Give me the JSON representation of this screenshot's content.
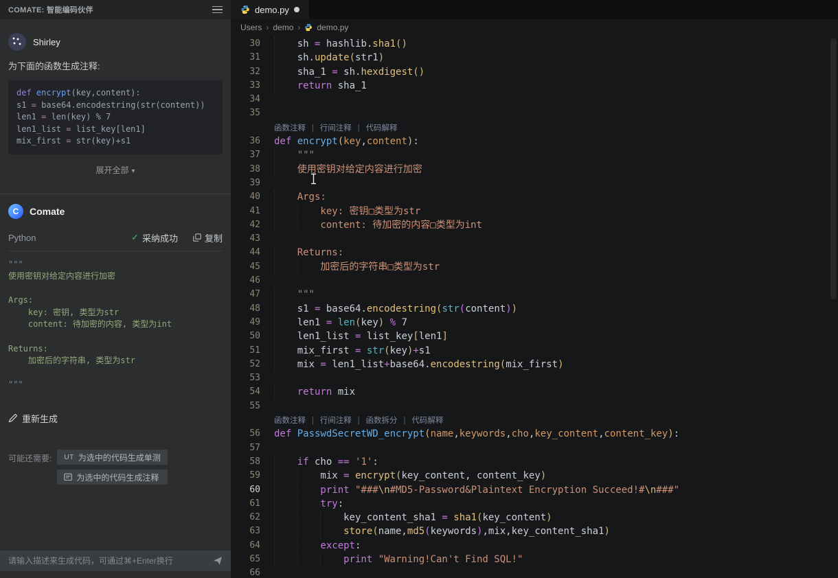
{
  "icons": {
    "check": "✓",
    "chevron_down": "▾",
    "breadcrumb_separator": "›"
  },
  "colors": {
    "sidebar_bg": "#2b2d2f",
    "editor_bg": "#161718",
    "keyword": "#c678dd",
    "function_name": "#61afef",
    "call": "#e5c07b",
    "builtin": "#56b6c2",
    "parameter": "#d19a66",
    "string": "#ce9178",
    "bracket": "#d7ba7d",
    "gutter": "#8f8775",
    "codelens": "#7d89a1",
    "success_green": "#3dc257",
    "docstring_green": "#94a97b"
  },
  "sidebar": {
    "header": {
      "title": "COMATE: 智能编码伙伴"
    },
    "user": {
      "name": "Shirley"
    },
    "prompt_label": "为下面的函数生成注释:",
    "snippet_lines": [
      [
        [
          "k",
          "def "
        ],
        [
          "fn",
          "encrypt"
        ],
        [
          "pl",
          "(key,content):"
        ]
      ],
      [
        [
          "pl",
          "s1 "
        ],
        [
          "op",
          "="
        ],
        [
          "pl",
          " base64.encodestring(str(content))"
        ]
      ],
      [
        [
          "pl",
          "len1 "
        ],
        [
          "op",
          "="
        ],
        [
          "pl",
          " len(key) % 7"
        ]
      ],
      [
        [
          "pl",
          "len1_list "
        ],
        [
          "op",
          "="
        ],
        [
          "pl",
          " list_key[len1]"
        ]
      ],
      [
        [
          "pl",
          "mix_first "
        ],
        [
          "op",
          "="
        ],
        [
          "pl",
          " str(key)+s1"
        ]
      ]
    ],
    "expand_label": "展开全部",
    "assistant": {
      "name": "Comate"
    },
    "result_header": {
      "lang": "Python",
      "adopt_status": "采纳成功",
      "copy_label": "复制"
    },
    "result_lines": [
      {
        "c": "q",
        "t": "\"\"\""
      },
      {
        "c": "g",
        "t": "使用密钥对给定内容进行加密"
      },
      {
        "c": "g",
        "t": ""
      },
      {
        "c": "g",
        "t": "Args:"
      },
      {
        "c": "g",
        "t": "    key: 密钥, 类型为str"
      },
      {
        "c": "g",
        "t": "    content: 待加密的内容, 类型为int"
      },
      {
        "c": "g",
        "t": ""
      },
      {
        "c": "g",
        "t": "Returns:"
      },
      {
        "c": "g",
        "t": "    加密后的字符串, 类型为str"
      },
      {
        "c": "g",
        "t": ""
      },
      {
        "c": "q",
        "t": "\"\"\""
      }
    ],
    "regenerate_label": "重新生成",
    "more_label": "可能还需要:",
    "suggestions": [
      {
        "prefix": "UT",
        "label": "为选中的代码生成单测"
      },
      {
        "prefix": "",
        "label": "为选中的代码生成注释"
      }
    ],
    "input": {
      "placeholder": "请输入描述来生成代码，可通过⌘+Enter换行"
    }
  },
  "editor": {
    "tab": {
      "title": "demo.py",
      "modified": true
    },
    "breadcrumb": [
      "Users",
      "demo",
      "demo.py"
    ],
    "lens_separator": " | ",
    "lines": [
      {
        "n": 30,
        "ind": 1,
        "t": [
          [
            "pl",
            "sh "
          ],
          [
            "op",
            "="
          ],
          [
            "pl",
            " hashlib."
          ],
          [
            "call",
            "sha1"
          ],
          [
            "br1",
            "()"
          ]
        ]
      },
      {
        "n": 31,
        "ind": 1,
        "t": [
          [
            "pl",
            "sh."
          ],
          [
            "call",
            "update"
          ],
          [
            "br1",
            "("
          ],
          [
            "pl",
            "str1"
          ],
          [
            "br1",
            ")"
          ]
        ]
      },
      {
        "n": 32,
        "ind": 1,
        "t": [
          [
            "pl",
            "sha_1 "
          ],
          [
            "op",
            "="
          ],
          [
            "pl",
            " sh."
          ],
          [
            "call",
            "hexdigest"
          ],
          [
            "br1",
            "()"
          ]
        ]
      },
      {
        "n": 33,
        "ind": 1,
        "t": [
          [
            "k",
            "return"
          ],
          [
            "pl",
            " sha_1"
          ]
        ]
      },
      {
        "n": 34,
        "ind": 0,
        "t": []
      },
      {
        "n": 35,
        "ind": 0,
        "t": []
      },
      {
        "lens": [
          "函数注释",
          "行间注释",
          "代码解释"
        ]
      },
      {
        "n": 36,
        "ind": 0,
        "t": [
          [
            "k",
            "def "
          ],
          [
            "fn",
            "encrypt"
          ],
          [
            "br1",
            "("
          ],
          [
            "p",
            "key"
          ],
          [
            "pl",
            ","
          ],
          [
            "p",
            "content"
          ],
          [
            "br1",
            ")"
          ],
          [
            "pl",
            ":"
          ]
        ]
      },
      {
        "n": 37,
        "ind": 1,
        "t": [
          [
            "docq",
            "\"\"\""
          ]
        ]
      },
      {
        "n": 38,
        "ind": 1,
        "t": [
          [
            "doc",
            "使用密钥对给定内容进行加密"
          ]
        ]
      },
      {
        "n": 39,
        "ind": 0,
        "t": []
      },
      {
        "n": 40,
        "ind": 1,
        "t": [
          [
            "doc",
            "Args:"
          ]
        ]
      },
      {
        "n": 41,
        "ind": 2,
        "t": [
          [
            "doc",
            "key: 密钥"
          ],
          [
            "tofu",
            "□"
          ],
          [
            "doc",
            "类型为str"
          ]
        ]
      },
      {
        "n": 42,
        "ind": 2,
        "t": [
          [
            "doc",
            "content: 待加密的内容"
          ],
          [
            "tofu",
            "□"
          ],
          [
            "doc",
            "类型为int"
          ]
        ]
      },
      {
        "n": 43,
        "ind": 0,
        "t": []
      },
      {
        "n": 44,
        "ind": 1,
        "t": [
          [
            "doc",
            "Returns:"
          ]
        ]
      },
      {
        "n": 45,
        "ind": 2,
        "t": [
          [
            "doc",
            "加密后的字符串"
          ],
          [
            "tofu",
            "□"
          ],
          [
            "doc",
            "类型为str"
          ]
        ]
      },
      {
        "n": 46,
        "ind": 0,
        "t": []
      },
      {
        "n": 47,
        "ind": 1,
        "t": [
          [
            "docq",
            "\"\"\""
          ]
        ]
      },
      {
        "n": 48,
        "ind": 1,
        "t": [
          [
            "pl",
            "s1 "
          ],
          [
            "op",
            "="
          ],
          [
            "pl",
            " base64."
          ],
          [
            "call",
            "encodestring"
          ],
          [
            "br1",
            "("
          ],
          [
            "bi",
            "str"
          ],
          [
            "br2",
            "("
          ],
          [
            "pl",
            "content"
          ],
          [
            "br2",
            ")"
          ],
          [
            "br1",
            ")"
          ]
        ]
      },
      {
        "n": 49,
        "ind": 1,
        "t": [
          [
            "pl",
            "len1 "
          ],
          [
            "op",
            "="
          ],
          [
            "pl",
            " "
          ],
          [
            "bi",
            "len"
          ],
          [
            "br1",
            "("
          ],
          [
            "pl",
            "key"
          ],
          [
            "br1",
            ")"
          ],
          [
            "pl",
            " "
          ],
          [
            "op",
            "%"
          ],
          [
            "pl",
            " 7"
          ]
        ]
      },
      {
        "n": 50,
        "ind": 1,
        "t": [
          [
            "pl",
            "len1_list "
          ],
          [
            "op",
            "="
          ],
          [
            "pl",
            " list_key"
          ],
          [
            "br1",
            "["
          ],
          [
            "pl",
            "len1"
          ],
          [
            "br1",
            "]"
          ]
        ]
      },
      {
        "n": 51,
        "ind": 1,
        "t": [
          [
            "pl",
            "mix_first "
          ],
          [
            "op",
            "="
          ],
          [
            "pl",
            " "
          ],
          [
            "bi",
            "str"
          ],
          [
            "br1",
            "("
          ],
          [
            "pl",
            "key"
          ],
          [
            "br1",
            ")"
          ],
          [
            "op",
            "+"
          ],
          [
            "pl",
            "s1"
          ]
        ]
      },
      {
        "n": 52,
        "ind": 1,
        "t": [
          [
            "pl",
            "mix "
          ],
          [
            "op",
            "="
          ],
          [
            "pl",
            " len1_list"
          ],
          [
            "op",
            "+"
          ],
          [
            "pl",
            "base64."
          ],
          [
            "call",
            "encodestring"
          ],
          [
            "br1",
            "("
          ],
          [
            "pl",
            "mix_first"
          ],
          [
            "br1",
            ")"
          ]
        ]
      },
      {
        "n": 53,
        "ind": 0,
        "t": []
      },
      {
        "n": 54,
        "ind": 1,
        "t": [
          [
            "k",
            "return"
          ],
          [
            "pl",
            " mix"
          ]
        ]
      },
      {
        "n": 55,
        "ind": 0,
        "t": []
      },
      {
        "lens": [
          "函数注释",
          "行间注释",
          "函数拆分",
          "代码解释"
        ]
      },
      {
        "n": 56,
        "ind": 0,
        "t": [
          [
            "k",
            "def "
          ],
          [
            "fn",
            "PasswdSecretWD_encrypt"
          ],
          [
            "br1",
            "("
          ],
          [
            "p",
            "name"
          ],
          [
            "pl",
            ","
          ],
          [
            "p",
            "keywords"
          ],
          [
            "pl",
            ","
          ],
          [
            "p",
            "cho"
          ],
          [
            "pl",
            ","
          ],
          [
            "p",
            "key_content"
          ],
          [
            "pl",
            ","
          ],
          [
            "p",
            "content_key"
          ],
          [
            "br1",
            ")"
          ],
          [
            "pl",
            ":"
          ]
        ]
      },
      {
        "n": 57,
        "ind": 0,
        "t": []
      },
      {
        "n": 58,
        "ind": 1,
        "t": [
          [
            "k",
            "if"
          ],
          [
            "pl",
            " cho "
          ],
          [
            "op",
            "=="
          ],
          [
            "pl",
            " "
          ],
          [
            "s",
            "'1'"
          ],
          [
            "pl",
            ":"
          ]
        ]
      },
      {
        "n": 59,
        "ind": 2,
        "t": [
          [
            "pl",
            "mix "
          ],
          [
            "op",
            "="
          ],
          [
            "pl",
            " "
          ],
          [
            "call",
            "encrypt"
          ],
          [
            "br1",
            "("
          ],
          [
            "pl",
            "key_content, content_key"
          ],
          [
            "br1",
            ")"
          ]
        ]
      },
      {
        "n": 60,
        "ind": 2,
        "active": true,
        "t": [
          [
            "k",
            "print "
          ],
          [
            "s",
            "\"###"
          ],
          [
            "esc",
            "\\n"
          ],
          [
            "s",
            "#MD5-Password&Plaintext Encryption Succeed!#"
          ],
          [
            "esc",
            "\\n"
          ],
          [
            "s",
            "###\""
          ]
        ]
      },
      {
        "n": 61,
        "ind": 2,
        "t": [
          [
            "k",
            "try"
          ],
          [
            "pl",
            ":"
          ]
        ]
      },
      {
        "n": 62,
        "ind": 3,
        "t": [
          [
            "pl",
            "key_content_sha1 "
          ],
          [
            "op",
            "="
          ],
          [
            "pl",
            " "
          ],
          [
            "call",
            "sha1"
          ],
          [
            "br1",
            "("
          ],
          [
            "pl",
            "key_content"
          ],
          [
            "br1",
            ")"
          ]
        ]
      },
      {
        "n": 63,
        "ind": 3,
        "t": [
          [
            "call",
            "store"
          ],
          [
            "br1",
            "("
          ],
          [
            "pl",
            "name,"
          ],
          [
            "call",
            "md5"
          ],
          [
            "br2",
            "("
          ],
          [
            "pl",
            "keywords"
          ],
          [
            "br2",
            ")"
          ],
          [
            "pl",
            ",mix,key_content_sha1"
          ],
          [
            "br1",
            ")"
          ]
        ]
      },
      {
        "n": 64,
        "ind": 2,
        "t": [
          [
            "k",
            "except"
          ],
          [
            "pl",
            ":"
          ]
        ]
      },
      {
        "n": 65,
        "ind": 3,
        "t": [
          [
            "k",
            "print "
          ],
          [
            "s",
            "\"Warning!Can't Find SQL!\""
          ]
        ]
      },
      {
        "n": 66,
        "ind": 0,
        "t": []
      }
    ]
  }
}
